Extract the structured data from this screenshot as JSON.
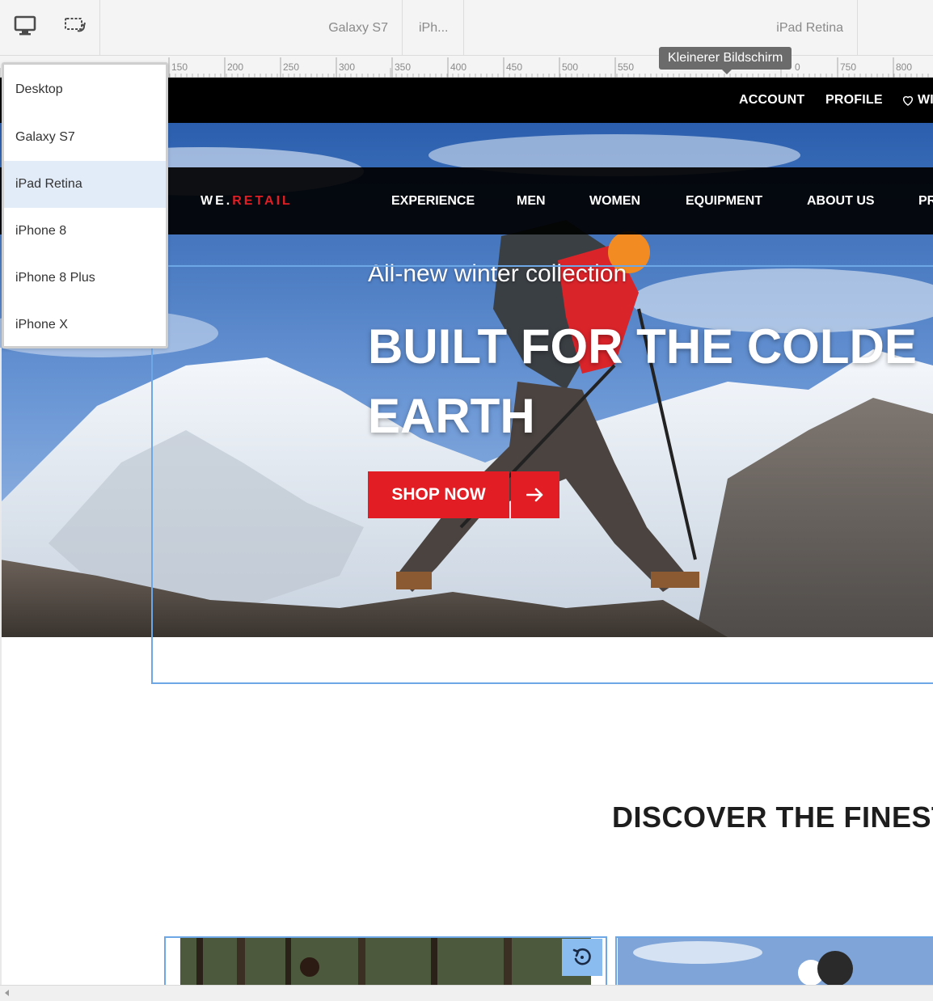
{
  "emulator": {
    "device_labels": [
      "Galaxy S7",
      "iPh...",
      "iPad Retina"
    ],
    "ruler_ticks": [
      "150",
      "200",
      "250",
      "300",
      "350",
      "400",
      "450",
      "500",
      "550",
      "750",
      "800"
    ],
    "ruler_tick_partial": "0",
    "tooltip": "Kleinerer Bildschirm",
    "dropdown": {
      "items": [
        "Desktop",
        "Galaxy S7",
        "iPad Retina",
        "iPhone 8",
        "iPhone 8 Plus",
        "iPhone X"
      ],
      "selected": "iPad Retina"
    }
  },
  "site": {
    "topbar": {
      "account": "ACCOUNT",
      "profile": "PROFILE",
      "wishlist": "WI"
    },
    "logo": {
      "prefix": "WE.",
      "accent": "RETAIL"
    },
    "nav": [
      "EXPERIENCE",
      "MEN",
      "WOMEN",
      "EQUIPMENT",
      "ABOUT US",
      "PR"
    ],
    "hero": {
      "subtitle": "All-new winter collection",
      "title_line1": "BUILT FOR THE COLDE",
      "title_line2": "EARTH",
      "cta": "SHOP NOW"
    },
    "section_title": "DISCOVER THE FINEST"
  },
  "colors": {
    "accent_red": "#e21d24",
    "selection_blue": "#6ea7e6",
    "dropdown_selected": "#e2ebf8"
  }
}
